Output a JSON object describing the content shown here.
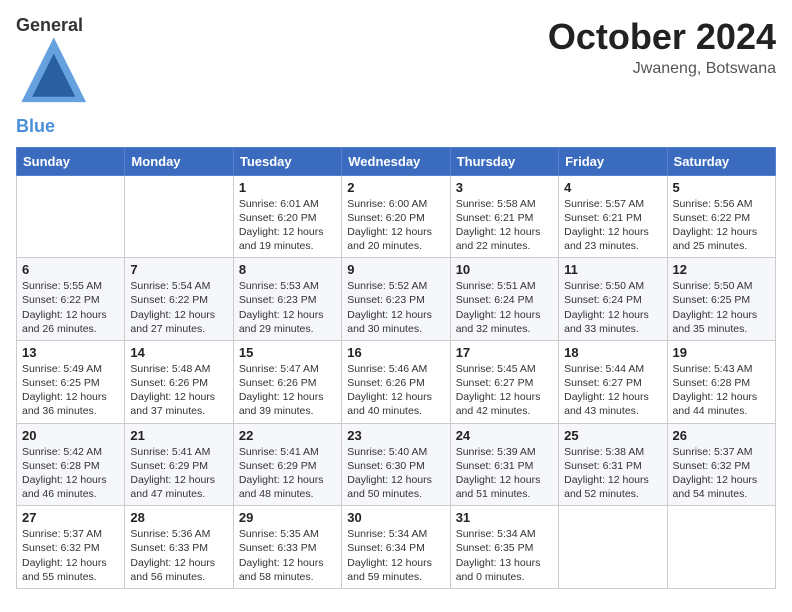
{
  "header": {
    "logo_general": "General",
    "logo_blue": "Blue",
    "month_title": "October 2024",
    "subtitle": "Jwaneng, Botswana"
  },
  "weekdays": [
    "Sunday",
    "Monday",
    "Tuesday",
    "Wednesday",
    "Thursday",
    "Friday",
    "Saturday"
  ],
  "weeks": [
    [
      {
        "day": "",
        "info": ""
      },
      {
        "day": "",
        "info": ""
      },
      {
        "day": "1",
        "info": "Sunrise: 6:01 AM\nSunset: 6:20 PM\nDaylight: 12 hours and 19 minutes."
      },
      {
        "day": "2",
        "info": "Sunrise: 6:00 AM\nSunset: 6:20 PM\nDaylight: 12 hours and 20 minutes."
      },
      {
        "day": "3",
        "info": "Sunrise: 5:58 AM\nSunset: 6:21 PM\nDaylight: 12 hours and 22 minutes."
      },
      {
        "day": "4",
        "info": "Sunrise: 5:57 AM\nSunset: 6:21 PM\nDaylight: 12 hours and 23 minutes."
      },
      {
        "day": "5",
        "info": "Sunrise: 5:56 AM\nSunset: 6:22 PM\nDaylight: 12 hours and 25 minutes."
      }
    ],
    [
      {
        "day": "6",
        "info": "Sunrise: 5:55 AM\nSunset: 6:22 PM\nDaylight: 12 hours and 26 minutes."
      },
      {
        "day": "7",
        "info": "Sunrise: 5:54 AM\nSunset: 6:22 PM\nDaylight: 12 hours and 27 minutes."
      },
      {
        "day": "8",
        "info": "Sunrise: 5:53 AM\nSunset: 6:23 PM\nDaylight: 12 hours and 29 minutes."
      },
      {
        "day": "9",
        "info": "Sunrise: 5:52 AM\nSunset: 6:23 PM\nDaylight: 12 hours and 30 minutes."
      },
      {
        "day": "10",
        "info": "Sunrise: 5:51 AM\nSunset: 6:24 PM\nDaylight: 12 hours and 32 minutes."
      },
      {
        "day": "11",
        "info": "Sunrise: 5:50 AM\nSunset: 6:24 PM\nDaylight: 12 hours and 33 minutes."
      },
      {
        "day": "12",
        "info": "Sunrise: 5:50 AM\nSunset: 6:25 PM\nDaylight: 12 hours and 35 minutes."
      }
    ],
    [
      {
        "day": "13",
        "info": "Sunrise: 5:49 AM\nSunset: 6:25 PM\nDaylight: 12 hours and 36 minutes."
      },
      {
        "day": "14",
        "info": "Sunrise: 5:48 AM\nSunset: 6:26 PM\nDaylight: 12 hours and 37 minutes."
      },
      {
        "day": "15",
        "info": "Sunrise: 5:47 AM\nSunset: 6:26 PM\nDaylight: 12 hours and 39 minutes."
      },
      {
        "day": "16",
        "info": "Sunrise: 5:46 AM\nSunset: 6:26 PM\nDaylight: 12 hours and 40 minutes."
      },
      {
        "day": "17",
        "info": "Sunrise: 5:45 AM\nSunset: 6:27 PM\nDaylight: 12 hours and 42 minutes."
      },
      {
        "day": "18",
        "info": "Sunrise: 5:44 AM\nSunset: 6:27 PM\nDaylight: 12 hours and 43 minutes."
      },
      {
        "day": "19",
        "info": "Sunrise: 5:43 AM\nSunset: 6:28 PM\nDaylight: 12 hours and 44 minutes."
      }
    ],
    [
      {
        "day": "20",
        "info": "Sunrise: 5:42 AM\nSunset: 6:28 PM\nDaylight: 12 hours and 46 minutes."
      },
      {
        "day": "21",
        "info": "Sunrise: 5:41 AM\nSunset: 6:29 PM\nDaylight: 12 hours and 47 minutes."
      },
      {
        "day": "22",
        "info": "Sunrise: 5:41 AM\nSunset: 6:29 PM\nDaylight: 12 hours and 48 minutes."
      },
      {
        "day": "23",
        "info": "Sunrise: 5:40 AM\nSunset: 6:30 PM\nDaylight: 12 hours and 50 minutes."
      },
      {
        "day": "24",
        "info": "Sunrise: 5:39 AM\nSunset: 6:31 PM\nDaylight: 12 hours and 51 minutes."
      },
      {
        "day": "25",
        "info": "Sunrise: 5:38 AM\nSunset: 6:31 PM\nDaylight: 12 hours and 52 minutes."
      },
      {
        "day": "26",
        "info": "Sunrise: 5:37 AM\nSunset: 6:32 PM\nDaylight: 12 hours and 54 minutes."
      }
    ],
    [
      {
        "day": "27",
        "info": "Sunrise: 5:37 AM\nSunset: 6:32 PM\nDaylight: 12 hours and 55 minutes."
      },
      {
        "day": "28",
        "info": "Sunrise: 5:36 AM\nSunset: 6:33 PM\nDaylight: 12 hours and 56 minutes."
      },
      {
        "day": "29",
        "info": "Sunrise: 5:35 AM\nSunset: 6:33 PM\nDaylight: 12 hours and 58 minutes."
      },
      {
        "day": "30",
        "info": "Sunrise: 5:34 AM\nSunset: 6:34 PM\nDaylight: 12 hours and 59 minutes."
      },
      {
        "day": "31",
        "info": "Sunrise: 5:34 AM\nSunset: 6:35 PM\nDaylight: 13 hours and 0 minutes."
      },
      {
        "day": "",
        "info": ""
      },
      {
        "day": "",
        "info": ""
      }
    ]
  ]
}
